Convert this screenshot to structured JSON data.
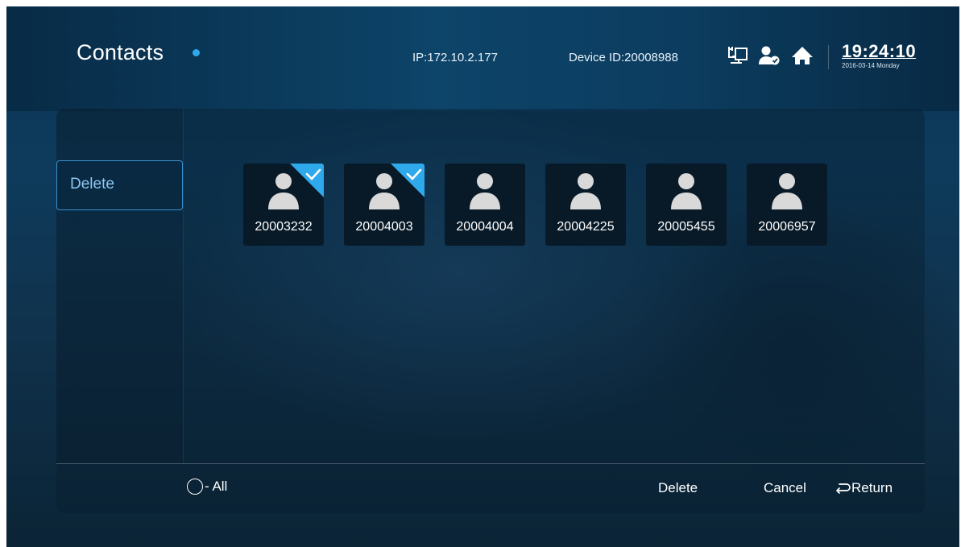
{
  "header": {
    "title": "Contacts",
    "ip": "IP:172.10.2.177",
    "device_id": "Device ID:20008988",
    "icons": [
      "network-icon",
      "user-status-icon",
      "home-icon"
    ],
    "time": "19:24:10",
    "date": "2016-03-14 Monday"
  },
  "sidebar": {
    "items": [
      {
        "label": "Delete",
        "selected": true
      }
    ]
  },
  "contacts": [
    {
      "number": "20003232",
      "checked": true
    },
    {
      "number": "20004003",
      "checked": true
    },
    {
      "number": "20004004",
      "checked": false
    },
    {
      "number": "20004225",
      "checked": false
    },
    {
      "number": "20005455",
      "checked": false
    },
    {
      "number": "20006957",
      "checked": false
    }
  ],
  "footer": {
    "select_all_label": "- All",
    "delete_label": "Delete",
    "cancel_label": "Cancel",
    "return_label": "Return"
  },
  "colors": {
    "accent": "#2ea9ec",
    "selected_border": "#3a8fd0",
    "check_badge": "#2ea9ec"
  }
}
